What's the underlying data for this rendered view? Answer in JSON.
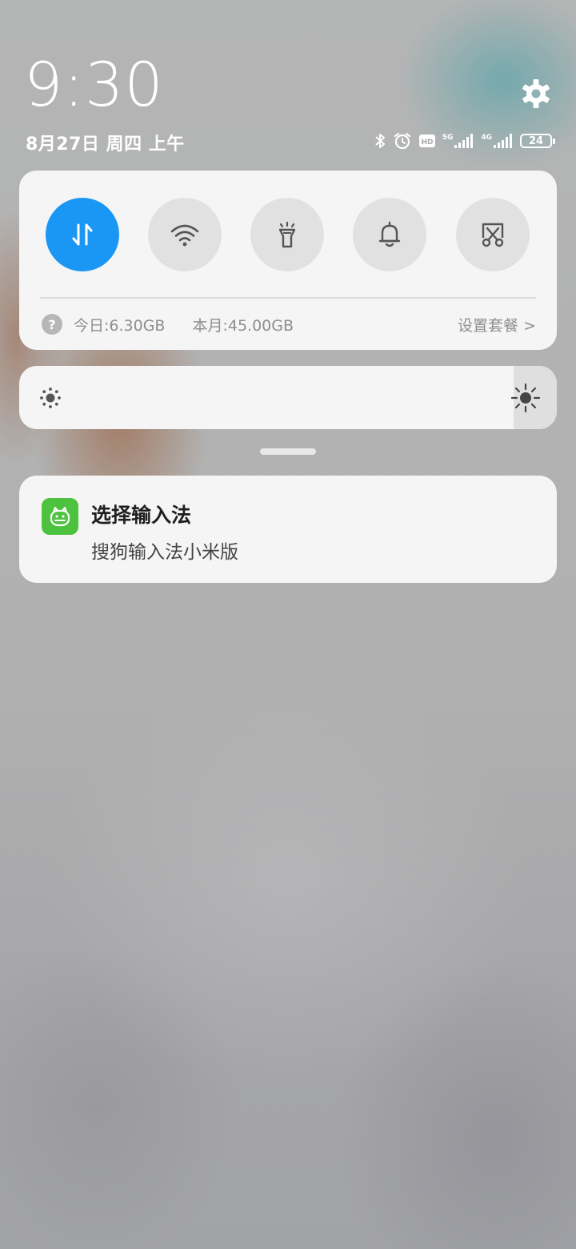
{
  "header": {
    "time": "9:30",
    "date": "8月27日 周四 上午",
    "settings_icon": "gear-icon"
  },
  "status_bar": {
    "icons": [
      "bluetooth-icon",
      "alarm-icon",
      "hd-icon",
      "signal-5g-icon",
      "signal-4g-icon",
      "battery-icon"
    ],
    "net1_label": "5G",
    "net2_label": "4G",
    "hd_label": "HD",
    "battery_level": "24"
  },
  "quick_settings": {
    "toggles": [
      {
        "name": "mobile-data",
        "icon": "data-arrows-icon",
        "active": true
      },
      {
        "name": "wifi",
        "icon": "wifi-icon",
        "active": false
      },
      {
        "name": "flashlight",
        "icon": "flashlight-icon",
        "active": false
      },
      {
        "name": "ringer",
        "icon": "bell-icon",
        "active": false
      },
      {
        "name": "screenshot",
        "icon": "screenshot-icon",
        "active": false
      }
    ],
    "data_usage": {
      "today": "今日:6.30GB",
      "month": "本月:45.00GB",
      "plan_link": "设置套餐 >"
    },
    "colors": {
      "active": "#1a97f5",
      "inactive": "#e1e1e1"
    }
  },
  "brightness": {
    "level_percent": 92
  },
  "notification": {
    "app_icon": "sogou-input-icon",
    "app_color": "#4cc23f",
    "title": "选择输入法",
    "body": "搜狗输入法小米版"
  }
}
